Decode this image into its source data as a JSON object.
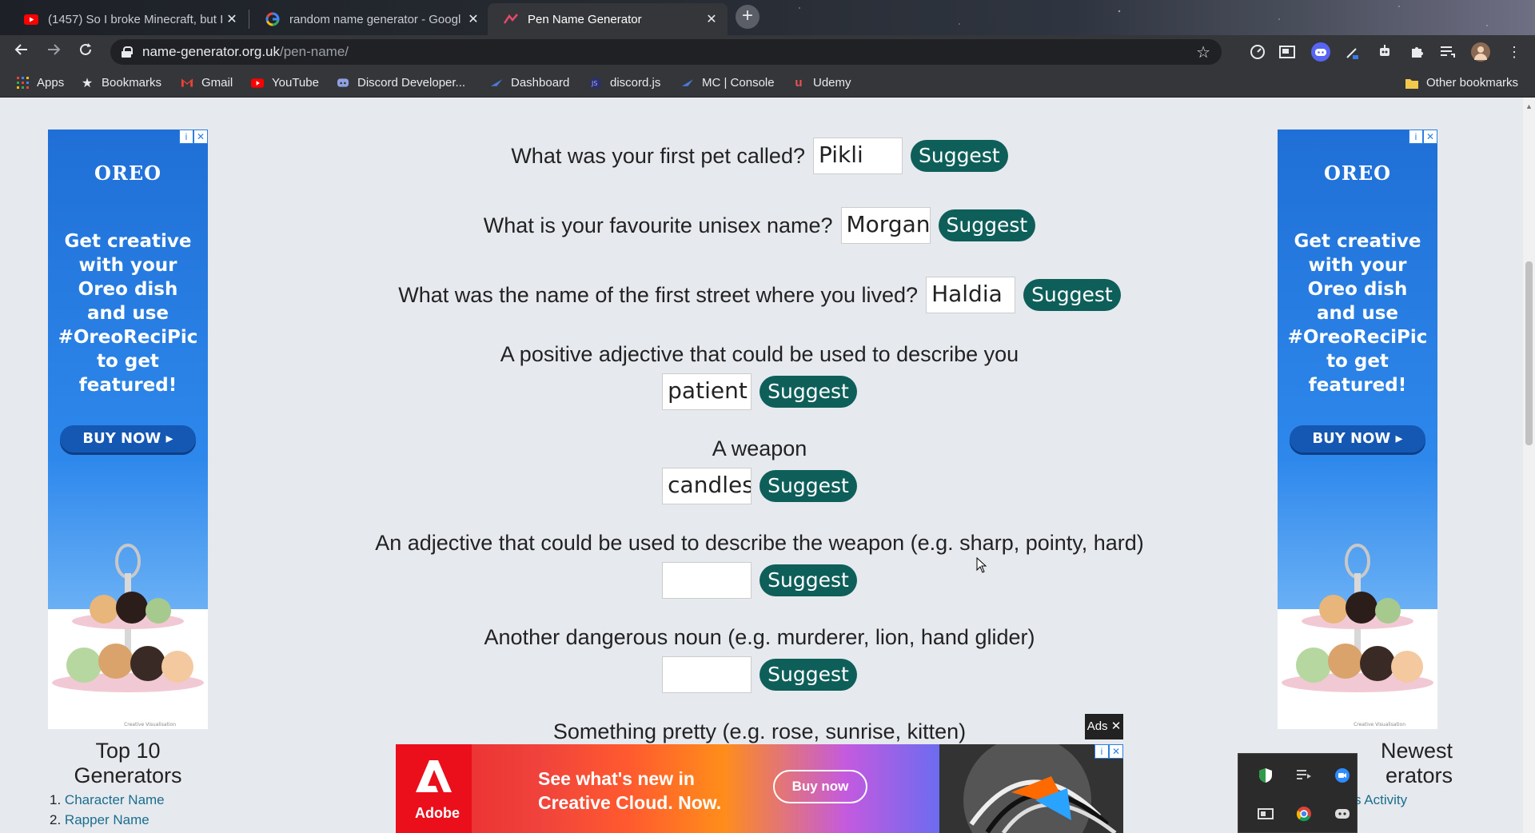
{
  "browser": {
    "tabs": [
      {
        "title": "(1457) So I broke Minecraft, but I",
        "icon": "youtube-icon",
        "active": false
      },
      {
        "title": "random name generator - Googl",
        "icon": "google-icon",
        "active": false
      },
      {
        "title": "Pen Name Generator",
        "icon": "name-generator-icon",
        "active": true
      }
    ],
    "new_tab": "+",
    "close_glyph": "✕",
    "url_host": "name-generator.org.uk",
    "url_path": "/pen-name/",
    "bookmarks": [
      {
        "label": "Apps",
        "icon": "apps-grid-icon"
      },
      {
        "label": "Bookmarks",
        "icon": "star-icon"
      },
      {
        "label": "Gmail",
        "icon": "gmail-icon"
      },
      {
        "label": "YouTube",
        "icon": "youtube-icon"
      },
      {
        "label": "Discord Developer...",
        "icon": "discord-icon"
      },
      {
        "label": "Dashboard",
        "icon": "dashboard-icon"
      },
      {
        "label": "discord.js",
        "icon": "discordjs-icon"
      },
      {
        "label": "MC | Console",
        "icon": "mc-console-icon"
      },
      {
        "label": "Udemy",
        "icon": "udemy-icon"
      }
    ],
    "other_bookmarks": "Other bookmarks"
  },
  "form": {
    "suggest_label": "Suggest",
    "q_pet": {
      "label": "What was your first pet called?",
      "value": "Pikli"
    },
    "q_unisex": {
      "label": "What is your favourite unisex name?",
      "value": "Morgan"
    },
    "q_street": {
      "label": "What was the name of the first street where you lived?",
      "value": "Haldia"
    },
    "q_adjective": {
      "label": "A positive adjective that could be used to describe you",
      "value": "patient"
    },
    "q_weapon": {
      "label": "A weapon",
      "value": "candlest"
    },
    "q_weapon_adj": {
      "label": "An adjective that could be used to describe the weapon (e.g. sharp, pointy, hard)",
      "value": ""
    },
    "q_noun": {
      "label": "Another dangerous noun (e.g. murderer, lion, hand glider)",
      "value": ""
    },
    "q_pretty": {
      "label": "Something pretty (e.g. rose, sunrise, kitten)"
    }
  },
  "ads": {
    "side": {
      "brand": "OREO",
      "text": "Get creative with your Oreo dish and use #OreoReciPic to get featured!",
      "button": "BUY NOW ▸",
      "credit": "Creative Visualisation"
    },
    "adchoices_info": "i",
    "adchoices_close": "✕",
    "ads_tag": "Ads ✕",
    "bottom": {
      "brand": "Adobe",
      "message_line1": "See what's new in",
      "message_line2": "Creative Cloud. Now.",
      "button": "Buy now"
    }
  },
  "sidebar_left": {
    "title": "Top 10 Generators",
    "items": [
      {
        "num": "1.",
        "label": "Character Name"
      },
      {
        "num": "2.",
        "label": "Rapper Name"
      }
    ]
  },
  "sidebar_right": {
    "title_line1": "Newest",
    "title_line2": "erators",
    "items": [
      {
        "label": "s Activity"
      }
    ]
  },
  "colors": {
    "suggest_bg": "#0e5f5a",
    "page_bg": "#e6e9ee",
    "link": "#1b6e8e",
    "browser_chrome": "#35363a"
  }
}
